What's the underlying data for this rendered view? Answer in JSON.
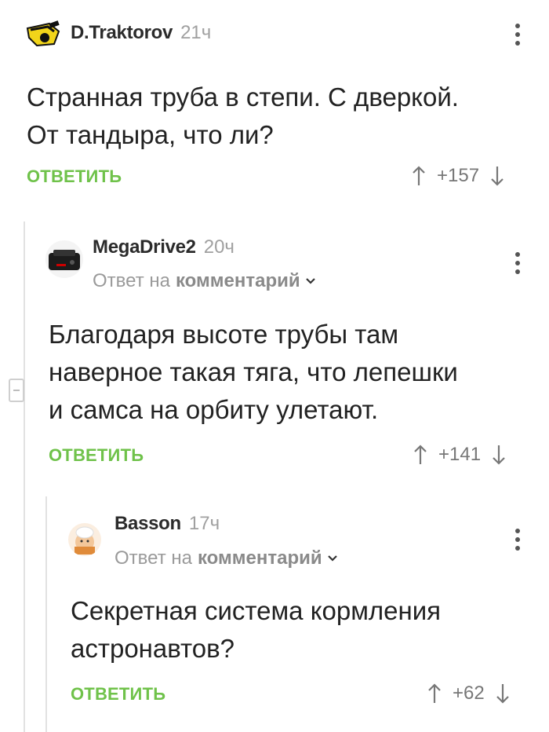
{
  "comments": [
    {
      "author": "D.Traktorov",
      "time": "21ч",
      "text_lines": [
        "Странная труба в степи. С дверкой.",
        "От тандыра, что ли?"
      ],
      "reply_label": "ОТВЕТИТЬ",
      "score": "+157"
    },
    {
      "author": "MegaDrive2",
      "time": "20ч",
      "reply_prefix": "Ответ на",
      "reply_link": "комментарий",
      "text_lines": [
        "Благодаря высоте трубы там",
        "наверное такая тяга, что лепешки",
        "и самса на орбиту улетают."
      ],
      "reply_label": "ОТВЕТИТЬ",
      "score": "+141"
    },
    {
      "author": "Basson",
      "time": "17ч",
      "reply_prefix": "Ответ на",
      "reply_link": "комментарий",
      "text_lines": [
        "Секретная система кормления",
        "астронавтов?"
      ],
      "reply_label": "ОТВЕТИТЬ",
      "score": "+62"
    }
  ],
  "colors": {
    "accent_green": "#6fc24a",
    "muted_text": "#a0a0a0",
    "thread_line": "#e2e2e2"
  },
  "icons": [
    "tractor-avatar-icon",
    "more-options-icon",
    "upvote-arrow-icon",
    "downvote-arrow-icon",
    "chevron-down-icon",
    "collapse-thread-icon"
  ]
}
